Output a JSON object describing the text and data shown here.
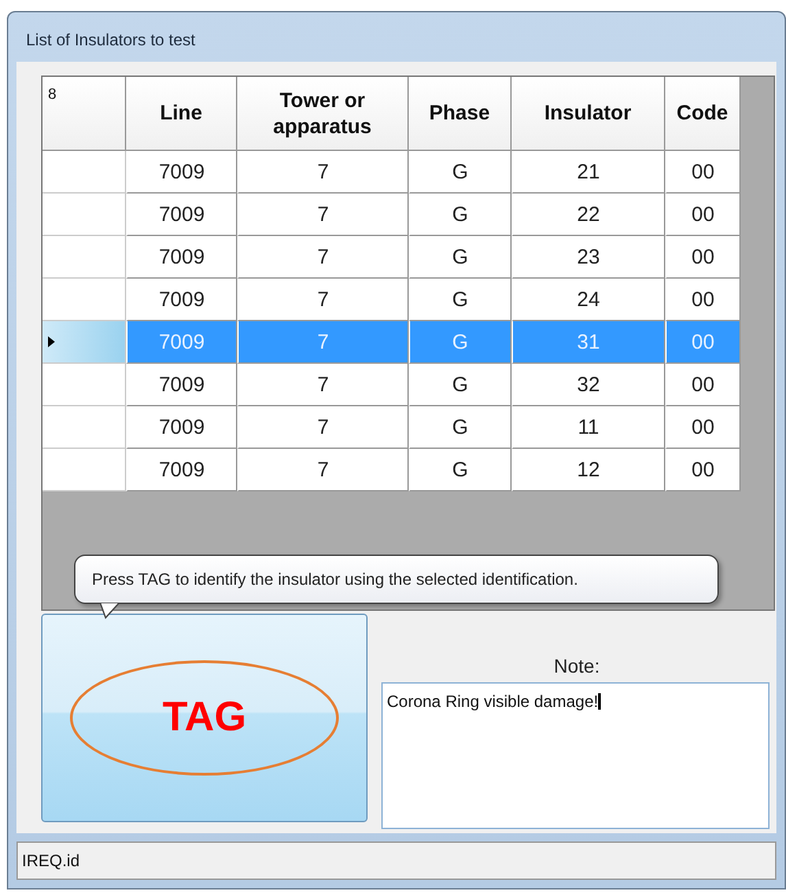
{
  "window": {
    "title": "List of Insulators to test"
  },
  "grid": {
    "corner": "8",
    "columns": [
      "Line",
      "Tower or apparatus",
      "Phase",
      "Insulator",
      "Code"
    ],
    "rows": [
      {
        "cells": [
          "7009",
          "7",
          "G",
          "21",
          "00"
        ],
        "selected": false
      },
      {
        "cells": [
          "7009",
          "7",
          "G",
          "22",
          "00"
        ],
        "selected": false
      },
      {
        "cells": [
          "7009",
          "7",
          "G",
          "23",
          "00"
        ],
        "selected": false
      },
      {
        "cells": [
          "7009",
          "7",
          "G",
          "24",
          "00"
        ],
        "selected": false
      },
      {
        "cells": [
          "7009",
          "7",
          "G",
          "31",
          "00"
        ],
        "selected": true
      },
      {
        "cells": [
          "7009",
          "7",
          "G",
          "32",
          "00"
        ],
        "selected": false
      },
      {
        "cells": [
          "7009",
          "7",
          "G",
          "11",
          "00"
        ],
        "selected": false
      },
      {
        "cells": [
          "7009",
          "7",
          "G",
          "12",
          "00"
        ],
        "selected": false
      }
    ]
  },
  "tooltip": "Press TAG to identify the insulator using the selected identification.",
  "tag_button": "TAG",
  "note": {
    "label": "Note:",
    "value": "Corona Ring visible damage!"
  },
  "status_bar": "IREQ.id"
}
